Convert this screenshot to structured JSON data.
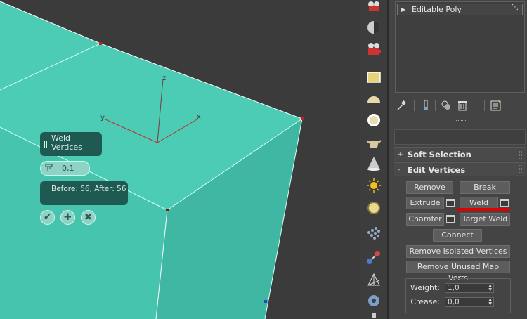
{
  "viewport": {
    "caddy_title": "Weld Vertices",
    "threshold_value": "0,1",
    "result_text": "Before: 56, After: 56",
    "axis_labels": {
      "z": "z",
      "y": "y",
      "x": "x"
    },
    "caddy_buttons": [
      {
        "name": "ok-icon",
        "glyph": "✔"
      },
      {
        "name": "apply-and-continue-icon",
        "glyph": "✚"
      },
      {
        "name": "cancel-icon",
        "glyph": "✖"
      }
    ]
  },
  "modifier_stack": {
    "item": "Editable Poly"
  },
  "rollouts": {
    "soft_selection": {
      "sign": "+",
      "label": "Soft Selection"
    },
    "edit_vertices": {
      "sign": "-",
      "label": "Edit Vertices"
    }
  },
  "buttons": {
    "remove": "Remove",
    "break": "Break",
    "extrude": "Extrude",
    "weld": "Weld",
    "chamfer": "Chamfer",
    "target_weld": "Target Weld",
    "connect": "Connect",
    "remove_isolated": "Remove Isolated Vertices",
    "remove_unused": "Remove Unused Map Verts"
  },
  "spinners": {
    "weight_label": "Weight:",
    "weight_value": "1,0",
    "crease_label": "Crease:",
    "crease_value": "0,0"
  },
  "colors": {
    "mesh_top": "#4ccbb5",
    "mesh_front": "#3bb39e",
    "highlight_red": "#e00000"
  }
}
